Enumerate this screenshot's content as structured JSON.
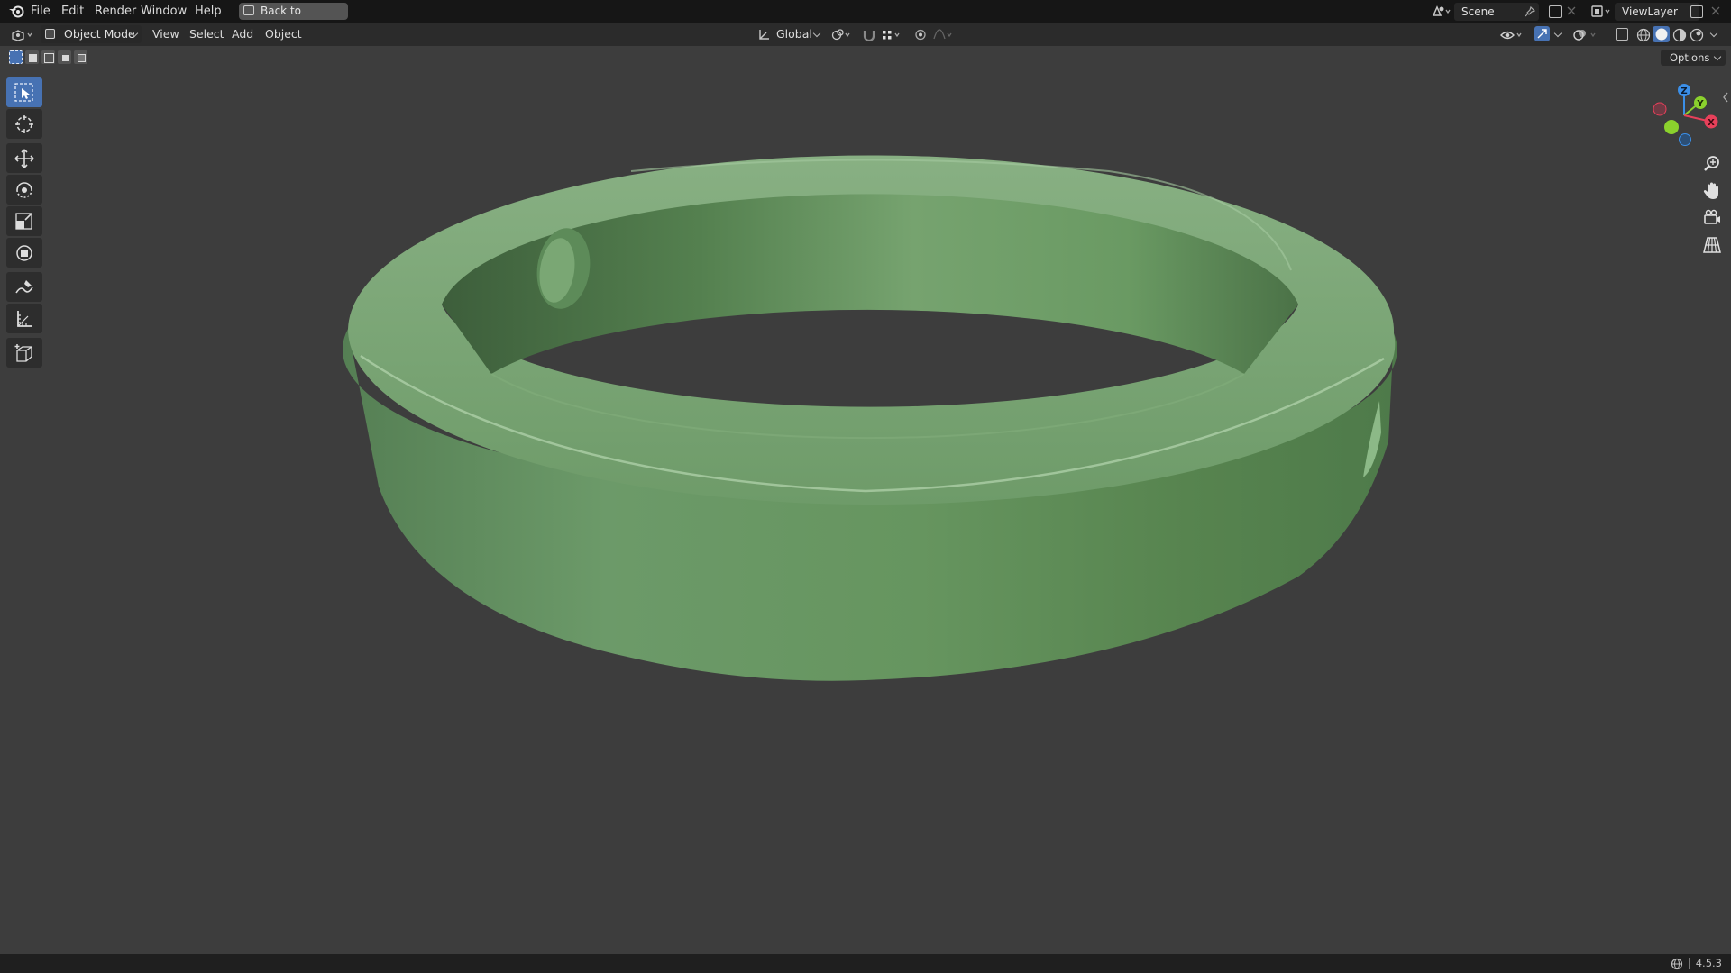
{
  "topbar": {
    "menus": [
      "File",
      "Edit",
      "Render",
      "Window",
      "Help"
    ],
    "back_label": "Back to Previous",
    "scene_label": "Scene",
    "viewlayer_label": "ViewLayer"
  },
  "header": {
    "mode_label": "Object Mode",
    "menus": [
      "View",
      "Select",
      "Add",
      "Object"
    ],
    "transform_orientation": "Global",
    "options_label": "Options"
  },
  "gizmo": {
    "x_label": "X",
    "y_label": "Y",
    "z_label": "Z",
    "x_color": "#e8405a",
    "y_color": "#8bd12d",
    "z_color": "#3b8fe8"
  },
  "viewport": {
    "background": "#3d3d3d",
    "object_color": "#6a9a68"
  },
  "tools": [
    "select-box",
    "cursor",
    "move",
    "rotate",
    "scale",
    "transform",
    "annotate",
    "measure",
    "add-cube"
  ],
  "status": {
    "version": "4.5.3"
  }
}
